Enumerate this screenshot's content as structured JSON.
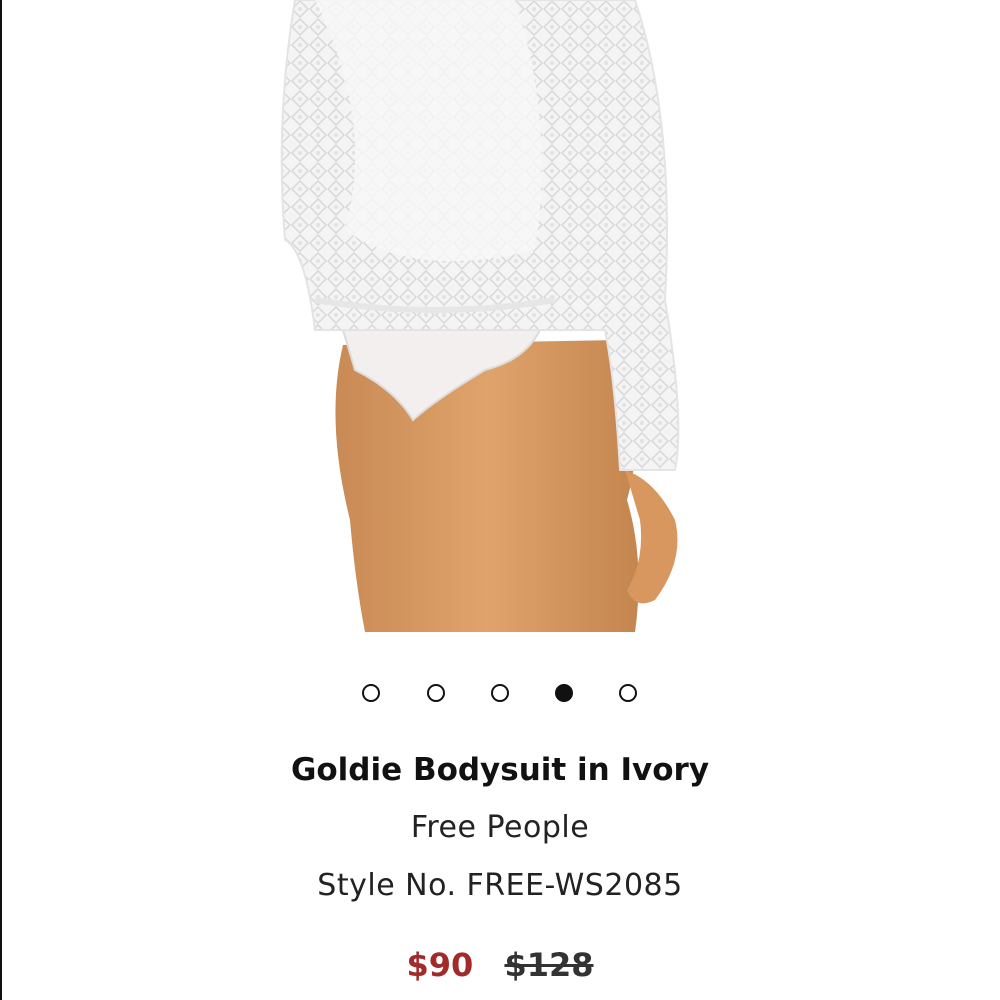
{
  "product": {
    "title": "Goldie Bodysuit in Ivory",
    "brand": "Free People",
    "style_no": "Style No. FREE-WS2085",
    "price_sale": "$90",
    "price_original": "$128",
    "sale_color": "#a32a2a"
  },
  "carousel": {
    "total": 5,
    "active_index": 3
  }
}
